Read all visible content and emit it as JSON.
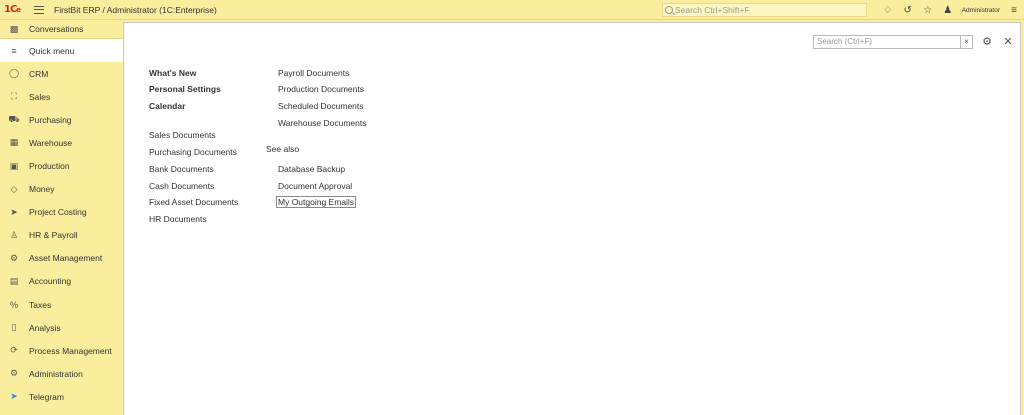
{
  "topbar": {
    "title": "FirstBit ERP / Administrator  (1C:Enterprise)",
    "search_placeholder": "Search Ctrl+Shift+F",
    "user": "Administrator"
  },
  "sidebar": {
    "conversations": "Conversations",
    "items": [
      {
        "label": "Quick menu",
        "icon": "hamburger-icon"
      },
      {
        "label": "CRM",
        "icon": "chat-icon"
      },
      {
        "label": "Sales",
        "icon": "shop-icon"
      },
      {
        "label": "Purchasing",
        "icon": "truck-icon"
      },
      {
        "label": "Warehouse",
        "icon": "warehouse-icon"
      },
      {
        "label": "Production",
        "icon": "factory-icon"
      },
      {
        "label": "Money",
        "icon": "money-icon"
      },
      {
        "label": "Project Costing",
        "icon": "rocket-icon"
      },
      {
        "label": "HR & Payroll",
        "icon": "person-icon"
      },
      {
        "label": "Asset Management",
        "icon": "asset-icon"
      },
      {
        "label": "Accounting",
        "icon": "ledger-icon"
      },
      {
        "label": "Taxes",
        "icon": "percent-icon"
      },
      {
        "label": "Analysis",
        "icon": "chart-icon"
      },
      {
        "label": "Process Management",
        "icon": "process-icon"
      },
      {
        "label": "Administration",
        "icon": "gear-icon"
      },
      {
        "label": "Telegram",
        "icon": "telegram-icon"
      }
    ]
  },
  "panel": {
    "search_placeholder": "Search (Ctrl+F)",
    "clear": "×",
    "col1_bold": [
      "What's New",
      "Personal Settings",
      "Calendar"
    ],
    "col1": [
      "Sales Documents",
      "Purchasing Documents",
      "Bank Documents",
      "Cash Documents",
      "Fixed Asset Documents",
      "HR Documents"
    ],
    "col2": [
      "Payroll Documents",
      "Production Documents",
      "Scheduled Documents",
      "Warehouse Documents"
    ],
    "see_also": "See also",
    "see_also_items": [
      "Database Backup",
      "Document Approval",
      "My Outgoing Emails"
    ]
  }
}
